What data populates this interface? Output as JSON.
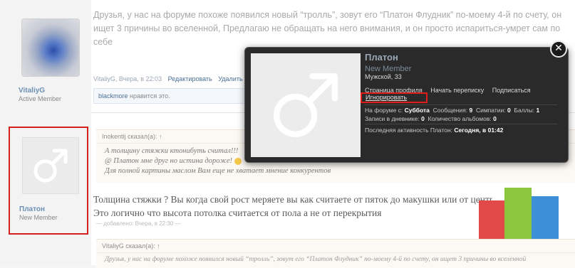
{
  "post1": {
    "text": "Друзья, у нас на форуме похоже появился новый “тролль”, зовут его “Платон Флудник” по-моему 4-й по счету, он ищет 3 причины во вселенной, Предлагаю не обращать на него внимания, и он просто испариться-умрет сам по себе",
    "username": "VitaliyG",
    "role": "Active Member",
    "meta_author_date": "VitaliyG, Вчера, в 22:03",
    "edit_label": "Редактировать",
    "delete_label": "Удалить",
    "likes_user": "blackmore",
    "likes_text": " нравится это."
  },
  "post2": {
    "username": "Платон",
    "role": "New Member",
    "quote1_header": "Inokentij сказал(а): ↑",
    "quote1_lines": [
      "А толщину стяжки ктонибуть считал!!!",
      "@ Платон мне друг но истина дороже!",
      "Для полной картины маслом Вам еще не хватает мнение конкурентов"
    ],
    "text_line1": "Толщина стяжки ? Вы когда свой рост меряете вы как считаете от пяток до макушки или от центра Земли до макушки.",
    "text_line2": "Это логично что высота потолка считается от пола а не от перекрытия",
    "edited_note": "— добавлено: Вчера, в 22:30 —",
    "quote2_header": "VitaliyG сказал(а): ↑",
    "quote2_line": "Друзья, у нас на форуме похоже появился новый “тролль”, зовут его “Платон Флудник” по-моему 4-й по счету, он ищет 3 причины во вселенной"
  },
  "popup": {
    "name": "Платон",
    "role": "New Member",
    "gender_age": "Мужской, 33",
    "links": [
      "Страница профиля",
      "Начать переписку",
      "Подписаться"
    ],
    "ignore_label": "Игнорировать",
    "stat_forum_label": "На форуме с: ",
    "stat_forum_value": "Суббота",
    "stat_msgs_label": "Сообщения: ",
    "stat_msgs_value": "9",
    "stat_likes_label": "Симпатии: ",
    "stat_likes_value": "0",
    "stat_points_label": "Баллы: ",
    "stat_points_value": "1",
    "stat_diary_label": "Записи в дневнике: ",
    "stat_diary_value": "0",
    "stat_albums_label": "Количество альбомов: ",
    "stat_albums_value": "0",
    "last_activity_label": "Последняя активность Платон: ",
    "last_activity_value": "Сегодня, в 01:42",
    "close_glyph": "✕"
  },
  "colors": {
    "highlight_red": "#d62020",
    "link_blue": "#4a6f97",
    "popup_bg": "#2a2a2a"
  }
}
